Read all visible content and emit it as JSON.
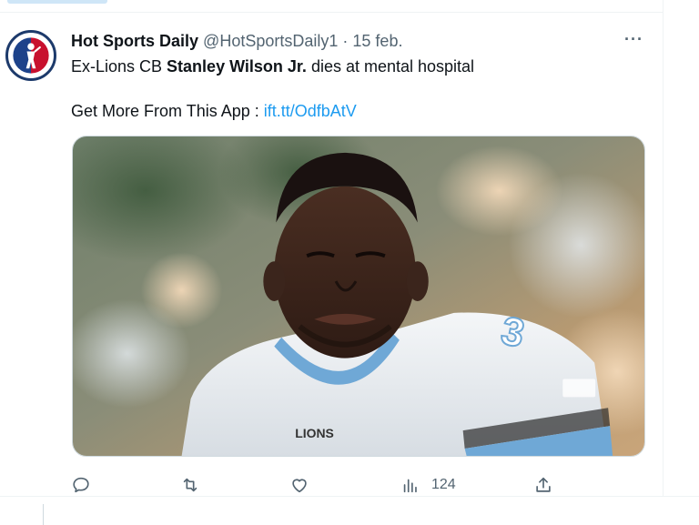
{
  "tweet": {
    "display_name": "Hot Sports Daily",
    "handle": "@HotSportsDaily1",
    "separator": "·",
    "date": "15 feb.",
    "more_label": "···",
    "text_prefix": "Ex-Lions CB ",
    "text_bold": "Stanley Wilson Jr.",
    "text_suffix": " dies at mental hospital",
    "link_prefix": "Get More From This App : ",
    "link_text": "ift.tt/OdfbAtV",
    "image_alt": "Football player in white and blue jersey",
    "jersey_number": "3",
    "jersey_word": "LIONS"
  },
  "actions": {
    "reply_icon": "reply-icon",
    "retweet_icon": "retweet-icon",
    "like_icon": "heart-icon",
    "views_icon": "views-icon",
    "views_count": "124",
    "share_icon": "share-icon"
  },
  "colors": {
    "link": "#1d9bf0",
    "muted": "#536471",
    "text": "#0f1419",
    "border": "#eff3f4"
  }
}
